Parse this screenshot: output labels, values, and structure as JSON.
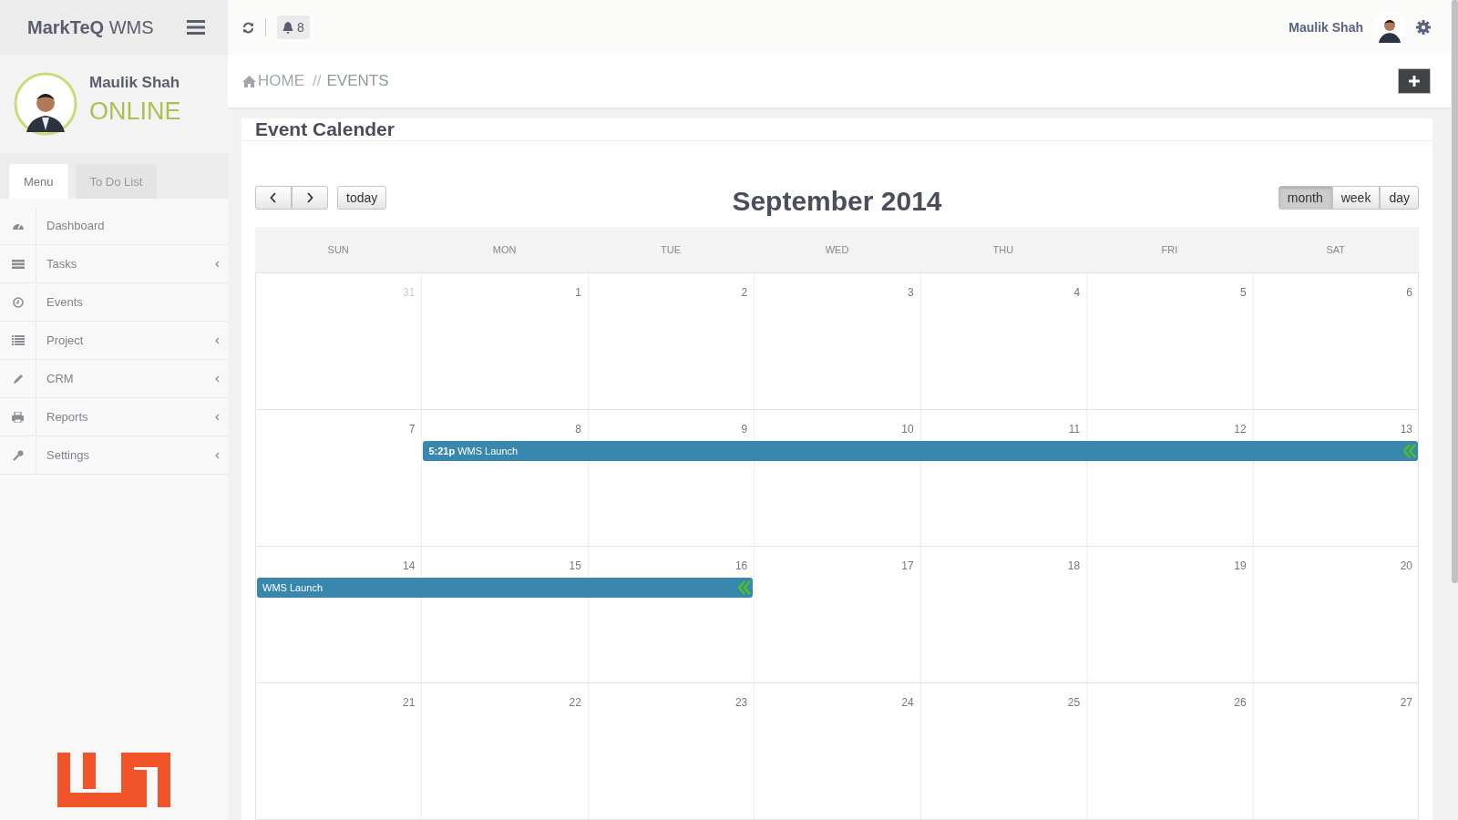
{
  "brand": {
    "name": "MarkTeQ",
    "suffix": "WMS"
  },
  "topbar": {
    "notifications": "8",
    "user": "Maulik Shah"
  },
  "profile": {
    "name": "Maulik Shah",
    "status": "ONLINE"
  },
  "sidebar_tabs": [
    {
      "label": "Menu",
      "selected": true
    },
    {
      "label": "To Do List",
      "selected": false
    }
  ],
  "sidebar": {
    "items": [
      {
        "label": "Dashboard",
        "submenu": false
      },
      {
        "label": "Tasks",
        "submenu": true
      },
      {
        "label": "Events",
        "submenu": false
      },
      {
        "label": "Project",
        "submenu": true
      },
      {
        "label": "CRM",
        "submenu": true
      },
      {
        "label": "Reports",
        "submenu": true
      },
      {
        "label": "Settings",
        "submenu": true
      }
    ]
  },
  "breadcrumb": {
    "home": "HOME",
    "separator": "//",
    "current": "EVENTS"
  },
  "card": {
    "title": "Event Calender"
  },
  "calendar": {
    "title": "September 2014",
    "today": "today",
    "views": [
      {
        "label": "month",
        "selected": true
      },
      {
        "label": "week",
        "selected": false
      },
      {
        "label": "day",
        "selected": false
      }
    ],
    "weekdays": [
      "SUN",
      "MON",
      "TUE",
      "WED",
      "THU",
      "FRI",
      "SAT"
    ],
    "weeks": [
      {
        "days": [
          {
            "n": "31",
            "other_month": true
          },
          {
            "n": "1",
            "other_month": false
          },
          {
            "n": "2",
            "other_month": false
          },
          {
            "n": "3",
            "other_month": false
          },
          {
            "n": "4",
            "other_month": false
          },
          {
            "n": "5",
            "other_month": false
          },
          {
            "n": "6",
            "other_month": false
          }
        ]
      },
      {
        "days": [
          {
            "n": "7",
            "other_month": false
          },
          {
            "n": "8",
            "other_month": false
          },
          {
            "n": "9",
            "other_month": false
          },
          {
            "n": "10",
            "other_month": false
          },
          {
            "n": "11",
            "other_month": false
          },
          {
            "n": "12",
            "other_month": false
          },
          {
            "n": "13",
            "other_month": false
          }
        ],
        "events": [
          {
            "time": "5:21p",
            "title": "WMS Launch",
            "resizable": true
          }
        ]
      },
      {
        "days": [
          {
            "n": "14",
            "other_month": false
          },
          {
            "n": "15",
            "other_month": false
          },
          {
            "n": "16",
            "other_month": false
          },
          {
            "n": "17",
            "other_month": false
          },
          {
            "n": "18",
            "other_month": false
          },
          {
            "n": "19",
            "other_month": false
          },
          {
            "n": "20",
            "other_month": false
          }
        ],
        "events": [
          {
            "title": "WMS Launch",
            "resizable": true
          }
        ]
      },
      {
        "days": [
          {
            "n": "21",
            "other_month": false
          },
          {
            "n": "22",
            "other_month": false
          },
          {
            "n": "23",
            "other_month": false
          },
          {
            "n": "24",
            "other_month": false
          },
          {
            "n": "25",
            "other_month": false
          },
          {
            "n": "26",
            "other_month": false
          },
          {
            "n": "27",
            "other_month": false
          }
        ]
      }
    ]
  }
}
